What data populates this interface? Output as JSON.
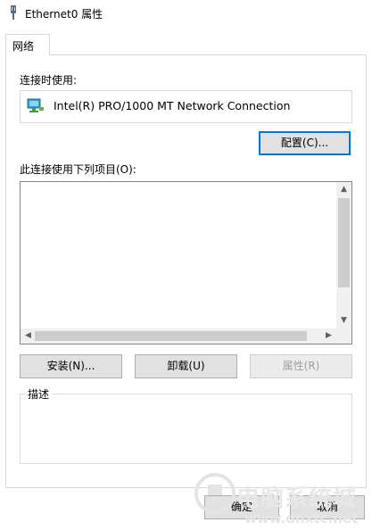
{
  "window": {
    "title": "Ethernet0 属性",
    "icon": "network-adapter-icon"
  },
  "tabs": [
    {
      "label": "网络",
      "selected": true
    }
  ],
  "connect_using": {
    "label": "连接时使用:",
    "adapter_name": "Intel(R) PRO/1000 MT Network Connection",
    "adapter_icon": "network-adapter-icon"
  },
  "buttons": {
    "configure": "配置(C)...",
    "install": "安装(N)...",
    "uninstall": "卸载(U)",
    "properties": "属性(R)",
    "ok": "确定",
    "cancel": "取消"
  },
  "items_list": {
    "label": "此连接使用下列项目(O):",
    "items": []
  },
  "description": {
    "label": "描述",
    "text": ""
  },
  "watermark": {
    "text": "电脑系统城",
    "subtext": "www.dnxtc.net"
  },
  "colors": {
    "accent": "#0078d7",
    "adapter_icon": "#2aa0d8"
  }
}
